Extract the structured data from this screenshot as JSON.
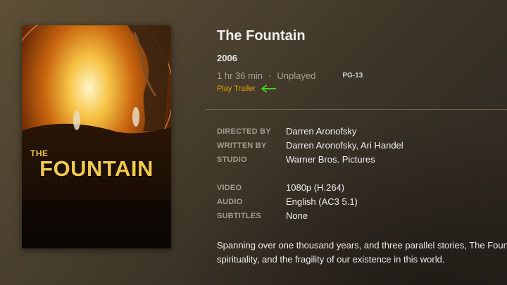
{
  "poster": {
    "title_small": "THE",
    "title_main": "FOUNTAIN"
  },
  "movie": {
    "title": "The Fountain",
    "year": "2006",
    "duration": "1 hr 36 min",
    "separator": "·",
    "watch_status": "Unplayed",
    "rating": "PG-13",
    "play_trailer_label": "Play Trailer"
  },
  "details": {
    "credits": [
      {
        "label": "DIRECTED BY",
        "value": "Darren Aronofsky"
      },
      {
        "label": "WRITTEN BY",
        "value": "Darren Aronofsky, Ari Handel"
      },
      {
        "label": "STUDIO",
        "value": "Warner Bros. Pictures"
      }
    ],
    "media": [
      {
        "label": "VIDEO",
        "value": "1080p (H.264)"
      },
      {
        "label": "AUDIO",
        "value": "English (AC3 5.1)"
      },
      {
        "label": "SUBTITLES",
        "value": "None"
      }
    ]
  },
  "summary": {
    "line1": "Spanning over one thousand years, and three parallel stories, The Fountain is a story of love, death,",
    "line2": "spirituality, and the fragility of our existence in this world."
  },
  "colors": {
    "accent": "#e5a00d",
    "annotation_arrow": "#46d11f"
  }
}
